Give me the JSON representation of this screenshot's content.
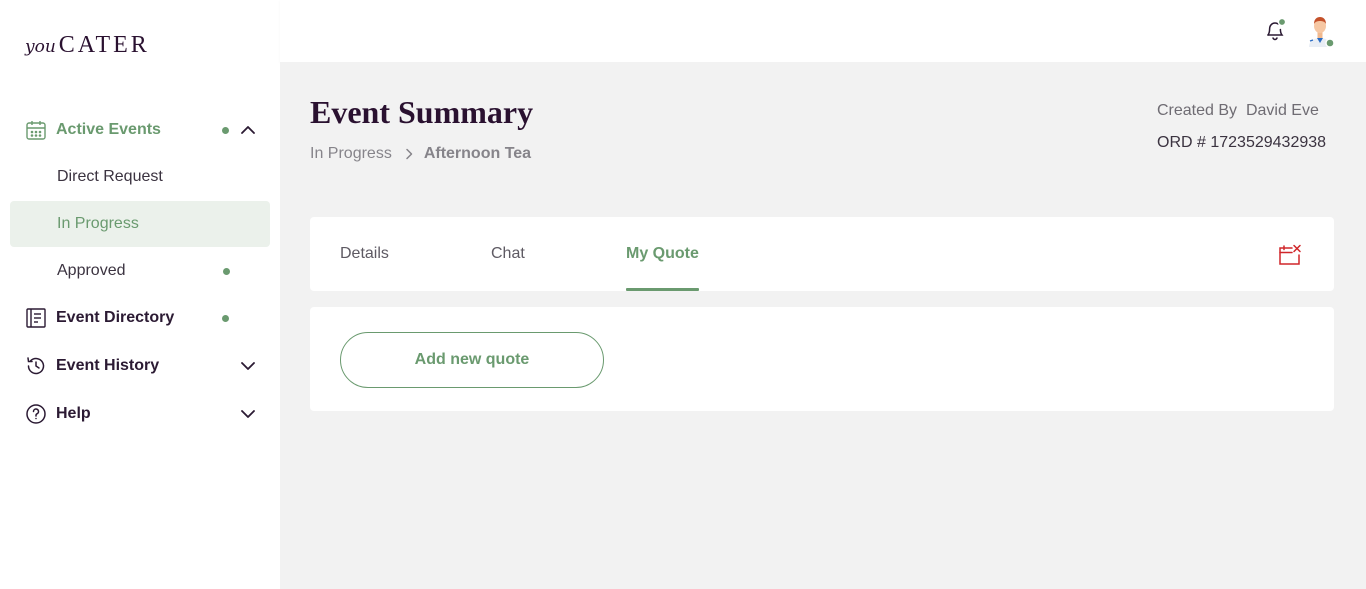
{
  "brand": {
    "prefix": "you",
    "name": "CATER"
  },
  "sidebar": {
    "active_events": {
      "label": "Active Events",
      "icon": "calendar-icon"
    },
    "sub_items": [
      {
        "label": "Direct Request",
        "active": false,
        "dot": false
      },
      {
        "label": "In Progress",
        "active": true,
        "dot": false
      },
      {
        "label": "Approved",
        "active": false,
        "dot": true
      }
    ],
    "event_directory": {
      "label": "Event Directory",
      "icon": "directory-icon"
    },
    "event_history": {
      "label": "Event History",
      "icon": "history-icon"
    },
    "help": {
      "label": "Help",
      "icon": "help-icon"
    }
  },
  "header": {
    "icons": [
      "bell-icon",
      "avatar"
    ]
  },
  "page": {
    "title": "Event Summary",
    "breadcrumb": [
      "In Progress",
      "Afternoon Tea"
    ],
    "created_by_label": "Created By",
    "created_by_name": "David Eve",
    "order_label": "ORD #",
    "order_number": "1723529432938"
  },
  "tabs": [
    {
      "label": "Details"
    },
    {
      "label": "Chat"
    },
    {
      "label": "My Quote"
    }
  ],
  "active_tab": "My Quote",
  "quote": {
    "add_button_label": "Add new quote"
  },
  "colors": {
    "accent": "#6a9a6f",
    "danger": "#d0262a",
    "title": "#2a1130",
    "main_bg": "#f2f2f2"
  }
}
